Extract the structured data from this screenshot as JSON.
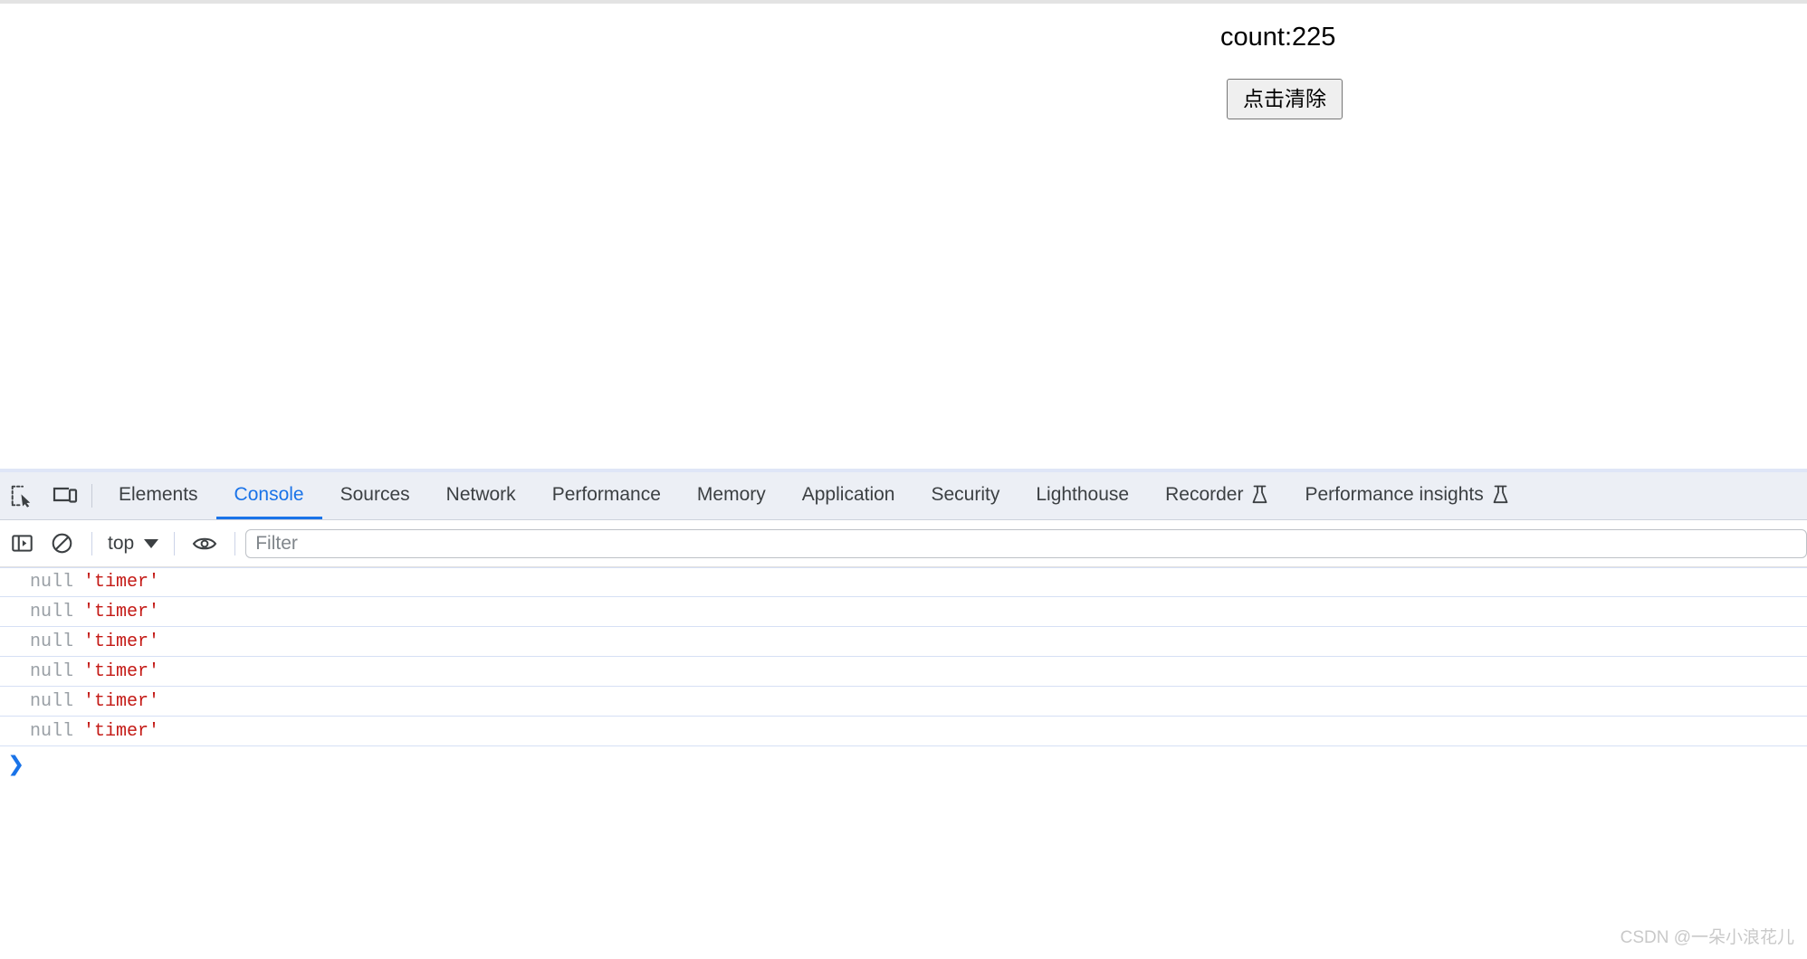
{
  "page": {
    "count_label": "count:225",
    "clear_button_label": "点击清除"
  },
  "devtools": {
    "inspect_icon": "inspect-element-icon",
    "device_icon": "device-toolbar-icon",
    "tabs": [
      {
        "label": "Elements",
        "active": false,
        "experimental": false
      },
      {
        "label": "Console",
        "active": true,
        "experimental": false
      },
      {
        "label": "Sources",
        "active": false,
        "experimental": false
      },
      {
        "label": "Network",
        "active": false,
        "experimental": false
      },
      {
        "label": "Performance",
        "active": false,
        "experimental": false
      },
      {
        "label": "Memory",
        "active": false,
        "experimental": false
      },
      {
        "label": "Application",
        "active": false,
        "experimental": false
      },
      {
        "label": "Security",
        "active": false,
        "experimental": false
      },
      {
        "label": "Lighthouse",
        "active": false,
        "experimental": false
      },
      {
        "label": "Recorder",
        "active": false,
        "experimental": true
      },
      {
        "label": "Performance insights",
        "active": false,
        "experimental": true
      }
    ],
    "active_tab_color": "#1a73e8",
    "toolbar": {
      "sidebar_icon": "console-sidebar-icon",
      "clear_icon": "clear-console-icon",
      "context_label": "top",
      "eye_icon": "live-expression-icon",
      "filter_placeholder": "Filter",
      "filter_value": ""
    },
    "console": {
      "rows": [
        {
          "null_text": "null",
          "string_text": "'timer'"
        },
        {
          "null_text": "null",
          "string_text": "'timer'"
        },
        {
          "null_text": "null",
          "string_text": "'timer'"
        },
        {
          "null_text": "null",
          "string_text": "'timer'"
        },
        {
          "null_text": "null",
          "string_text": "'timer'"
        },
        {
          "null_text": "null",
          "string_text": "'timer'"
        }
      ],
      "prompt_chevron": "❯",
      "null_color": "#9aa0a6",
      "string_color": "#c41a16"
    }
  },
  "watermark": {
    "text": "CSDN @一朵小浪花儿"
  }
}
